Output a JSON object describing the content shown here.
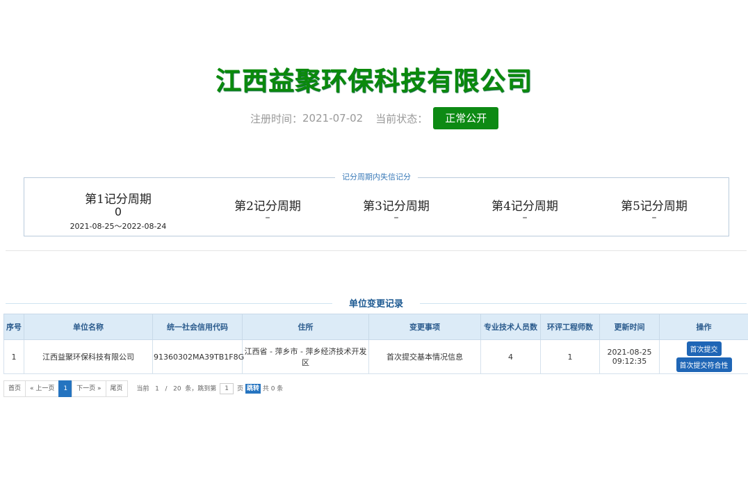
{
  "company": {
    "name": "江西益聚环保科技有限公司",
    "reg_label": "注册时间：",
    "reg_date": "2021-07-02",
    "status_label": "当前状态：",
    "status": "正常公开",
    "status_color": "#0d8a14"
  },
  "score_section": {
    "legend": "记分周期内失信记分",
    "periods": [
      {
        "title": "第1记分周期",
        "value": "0",
        "range": "2021-08-25～2022-08-24"
      },
      {
        "title": "第2记分周期",
        "value": "–"
      },
      {
        "title": "第3记分周期",
        "value": "–"
      },
      {
        "title": "第4记分周期",
        "value": "–"
      },
      {
        "title": "第5记分周期",
        "value": "–"
      }
    ]
  },
  "records": {
    "title": "单位变更记录",
    "headers": [
      "序号",
      "单位名称",
      "统一社会信用代码",
      "住所",
      "变更事项",
      "专业技术人员数",
      "环评工程师数",
      "更新时间",
      "操作"
    ],
    "rows": [
      {
        "index": "1",
        "name": "江西益聚环保科技有限公司",
        "credit_code": "91360302MA39TB1F8G",
        "address": "江西省 - 萍乡市 - 萍乡经济技术开发区",
        "change": "首次提交基本情况信息",
        "tech_staff": "4",
        "engineers": "1",
        "updated_date": "2021-08-25",
        "updated_time": "09:12:35",
        "actions": [
          "首次提交",
          "首次提交符合性"
        ]
      }
    ]
  },
  "pager": {
    "first": "首页",
    "prev": "« 上一页",
    "current_page": "1",
    "next": "下一页 »",
    "last": "尾页",
    "info_prefix": "当前",
    "page_num": "1",
    "slash": "/",
    "page_size": "20",
    "info_mid": "条，跳到第",
    "jump_value": "1",
    "info_page": "页",
    "jump_button": "跳转",
    "total": "共 0 条"
  }
}
